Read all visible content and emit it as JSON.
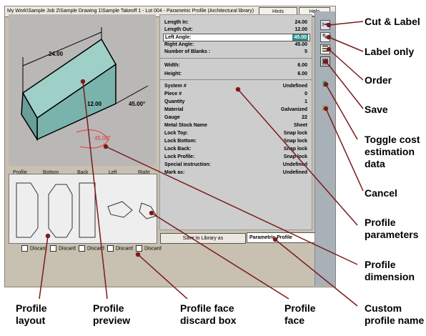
{
  "window": {
    "title": "My Work\\Sample Job 2\\Sample Drawing 1\\Sample Takeoff 1 - Lot 004 - Parametric Profile (Architectural library)",
    "hints_label": "Hints",
    "help_label": "Help"
  },
  "preview": {
    "dim_top": "24.00",
    "dim_mid": "12.00",
    "dim_right": "45.00°",
    "dim_angle": "45.00°"
  },
  "layout": {
    "headers": [
      "Profile",
      "Bottom",
      "Back",
      "Left",
      "Right"
    ],
    "discard_label": "Discard"
  },
  "params": {
    "rows1": [
      {
        "k": "Length In:",
        "v": "24.00"
      },
      {
        "k": "Length Out:",
        "v": "12.00"
      },
      {
        "k": "Left Angle:",
        "v": "45.00"
      },
      {
        "k": "Right Angle:",
        "v": "45.00"
      },
      {
        "k": "Number of Blanks :",
        "v": "5"
      }
    ],
    "rows2": [
      {
        "k": "Width:",
        "v": "6.00"
      },
      {
        "k": "Height:",
        "v": "6.00"
      }
    ],
    "rows3": [
      {
        "k": "System #",
        "v": "Undefined"
      },
      {
        "k": "Piece #",
        "v": "0"
      },
      {
        "k": "Quantity",
        "v": "1"
      },
      {
        "k": "Material",
        "v": "Galvanized"
      },
      {
        "k": "Gauge",
        "v": "22"
      },
      {
        "k": "Metal Stock Name",
        "v": "Sheet"
      },
      {
        "k": "Lock Top:",
        "v": "Snap lock"
      },
      {
        "k": "Lock Bottom:",
        "v": "Snap lock"
      },
      {
        "k": "Lock Back:",
        "v": "Snap lock"
      },
      {
        "k": "Lock Profile:",
        "v": "Snap lock"
      },
      {
        "k": "Special instruction:",
        "v": "Undefined"
      },
      {
        "k": "Mark as:",
        "v": "Undefined"
      }
    ]
  },
  "footer": {
    "save_library_label": "Save to Library as",
    "profile_name_value": "Parametric Profile"
  },
  "toolbar_icons": [
    "cut-and-label-icon",
    "label-only-icon",
    "order-icon",
    "save-icon",
    "toggle-cost-icon",
    "cancel-icon"
  ],
  "callouts": {
    "cut_label": "Cut & Label",
    "label_only": "Label only",
    "order": "Order",
    "save": "Save",
    "toggle_cost": "Toggle cost estimation data",
    "cancel": "Cancel",
    "profile_parameters": "Profile parameters",
    "profile_dimension": "Profile dimension",
    "custom_profile_name": "Custom profile name",
    "profile_layout": "Profile layout",
    "profile_preview": "Profile preview",
    "profile_face_discard": "Profile face discard box",
    "profile_face": "Profile face"
  },
  "colors": {
    "accent_line": "#7a1a1a",
    "callout_text": "#000000",
    "selection": "#2e8b8b",
    "profile_face": "#9fd0c8"
  }
}
